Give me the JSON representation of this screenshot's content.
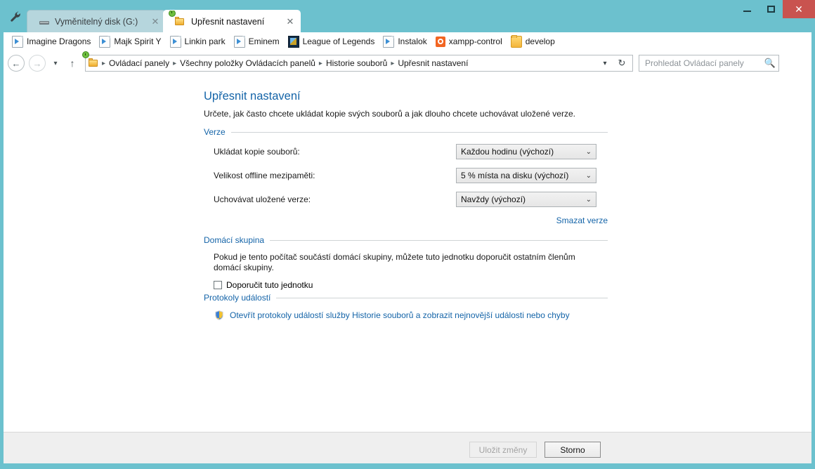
{
  "window": {
    "accent_color": "#6cc1ce",
    "close_color": "#c9534f",
    "link_color": "#1464a8",
    "controls": {
      "minimize": "minimize-icon",
      "maximize": "maximize-icon",
      "close": "✕"
    },
    "wrench_icon": "wrench-icon"
  },
  "tabs": [
    {
      "label": "Vyměnitelný disk (G:)",
      "icon": "removable-disk-icon",
      "close": "✕",
      "active": false
    },
    {
      "label": "Upřesnit nastavení",
      "icon": "file-history-icon",
      "close": "✕",
      "active": true
    }
  ],
  "bookmarks": [
    {
      "label": "Imagine Dragons",
      "icon": "page-icon"
    },
    {
      "label": "Majk Spirit Y",
      "icon": "page-icon"
    },
    {
      "label": "Linkin park",
      "icon": "page-icon"
    },
    {
      "label": "Eminem",
      "icon": "page-icon"
    },
    {
      "label": "League of Legends",
      "icon": "league-of-legends-icon"
    },
    {
      "label": "Instalok",
      "icon": "page-icon"
    },
    {
      "label": "xampp-control",
      "icon": "xampp-icon"
    },
    {
      "label": "develop",
      "icon": "folder-icon"
    }
  ],
  "navigation": {
    "back": "←",
    "forward": "→",
    "history_dropdown": "▾",
    "up": "↑",
    "breadcrumb_icon": "file-history-icon",
    "breadcrumbs": [
      "Ovládací panely",
      "Všechny položky Ovládacích panelů",
      "Historie souborů",
      "Upřesnit nastavení"
    ],
    "separator": "▸",
    "dropdown": "▾",
    "refresh": "↻"
  },
  "search": {
    "placeholder": "Prohledat Ovládací panely",
    "icon": "search-icon"
  },
  "page": {
    "title": "Upřesnit nastavení",
    "subtitle": "Určete, jak často chcete ukládat kopie svých souborů a jak dlouho chcete uchovávat uložené verze.",
    "sections": [
      {
        "heading": "Verze",
        "rows": [
          {
            "label": "Ukládat kopie souborů:",
            "value": "Každou hodinu (výchozí)",
            "arrow": "⌄"
          },
          {
            "label": "Velikost offline mezipaměti:",
            "value": "5 % místa na disku (výchozí)",
            "arrow": "⌄"
          },
          {
            "label": "Uchovávat uložené verze:",
            "value": "Navždy (výchozí)",
            "arrow": "⌄"
          }
        ],
        "link": "Smazat verze"
      },
      {
        "heading": "Domácí skupina",
        "paragraph": "Pokud je tento počítač součástí domácí skupiny, můžete tuto jednotku doporučit ostatním členům domácí skupiny.",
        "checkbox_label": "Doporučit tuto jednotku",
        "checkbox_checked": false
      },
      {
        "heading": "Protokoly událostí",
        "shield_icon": "uac-shield-icon",
        "link": "Otevřít protokoly událostí služby Historie souborů a zobrazit nejnovější události nebo chyby"
      }
    ]
  },
  "footer": {
    "save_label": "Uložit změny",
    "save_enabled": false,
    "cancel_label": "Storno"
  }
}
